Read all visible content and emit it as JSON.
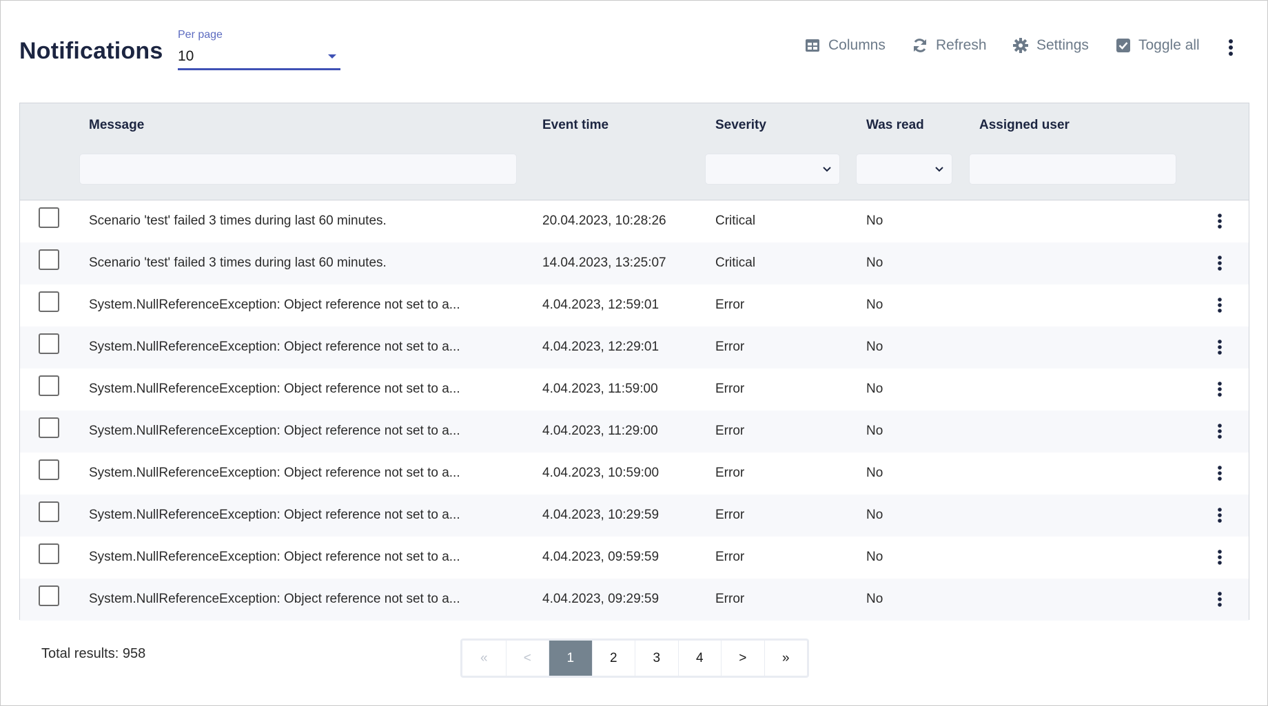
{
  "header": {
    "title": "Notifications",
    "per_page": {
      "label": "Per page",
      "value": "10"
    }
  },
  "toolbar": {
    "columns": {
      "label": "Columns",
      "icon": "table-columns-icon"
    },
    "refresh": {
      "label": "Refresh",
      "icon": "refresh-icon"
    },
    "settings": {
      "label": "Settings",
      "icon": "gear-icon"
    },
    "toggle_all": {
      "label": "Toggle all",
      "icon": "checkbox-checked-icon"
    },
    "more_icon": "vertical-ellipsis-icon"
  },
  "table": {
    "columns": [
      "Message",
      "Event time",
      "Severity",
      "Was read",
      "Assigned user"
    ],
    "filters": {
      "message": "",
      "severity": "",
      "was_read": "",
      "assigned_user": ""
    },
    "rows": [
      {
        "message": "Scenario 'test' failed 3 times during last 60 minutes.",
        "event_time": "20.04.2023, 10:28:26",
        "severity": "Critical",
        "was_read": "No",
        "assigned_user": ""
      },
      {
        "message": "Scenario 'test' failed 3 times during last 60 minutes.",
        "event_time": "14.04.2023, 13:25:07",
        "severity": "Critical",
        "was_read": "No",
        "assigned_user": ""
      },
      {
        "message": "System.NullReferenceException: Object reference not set to a...",
        "event_time": "4.04.2023, 12:59:01",
        "severity": "Error",
        "was_read": "No",
        "assigned_user": ""
      },
      {
        "message": "System.NullReferenceException: Object reference not set to a...",
        "event_time": "4.04.2023, 12:29:01",
        "severity": "Error",
        "was_read": "No",
        "assigned_user": ""
      },
      {
        "message": "System.NullReferenceException: Object reference not set to a...",
        "event_time": "4.04.2023, 11:59:00",
        "severity": "Error",
        "was_read": "No",
        "assigned_user": ""
      },
      {
        "message": "System.NullReferenceException: Object reference not set to a...",
        "event_time": "4.04.2023, 11:29:00",
        "severity": "Error",
        "was_read": "No",
        "assigned_user": ""
      },
      {
        "message": "System.NullReferenceException: Object reference not set to a...",
        "event_time": "4.04.2023, 10:59:00",
        "severity": "Error",
        "was_read": "No",
        "assigned_user": ""
      },
      {
        "message": "System.NullReferenceException: Object reference not set to a...",
        "event_time": "4.04.2023, 10:29:59",
        "severity": "Error",
        "was_read": "No",
        "assigned_user": ""
      },
      {
        "message": "System.NullReferenceException: Object reference not set to a...",
        "event_time": "4.04.2023, 09:59:59",
        "severity": "Error",
        "was_read": "No",
        "assigned_user": ""
      },
      {
        "message": "System.NullReferenceException: Object reference not set to a...",
        "event_time": "4.04.2023, 09:29:59",
        "severity": "Error",
        "was_read": "No",
        "assigned_user": ""
      }
    ]
  },
  "footer": {
    "total_results": "Total results: 958",
    "pagination": {
      "first": "«",
      "prev": "<",
      "pages": [
        "1",
        "2",
        "3",
        "4"
      ],
      "current": "1",
      "next": ">",
      "last": "»"
    }
  },
  "colors": {
    "title": "#1c2541",
    "accent": "#3f51b5",
    "toolbar_text": "#6c7a89",
    "header_bg": "#e9ecef",
    "row_alt_bg": "#f7f8fb",
    "active_page_bg": "#74838f"
  }
}
